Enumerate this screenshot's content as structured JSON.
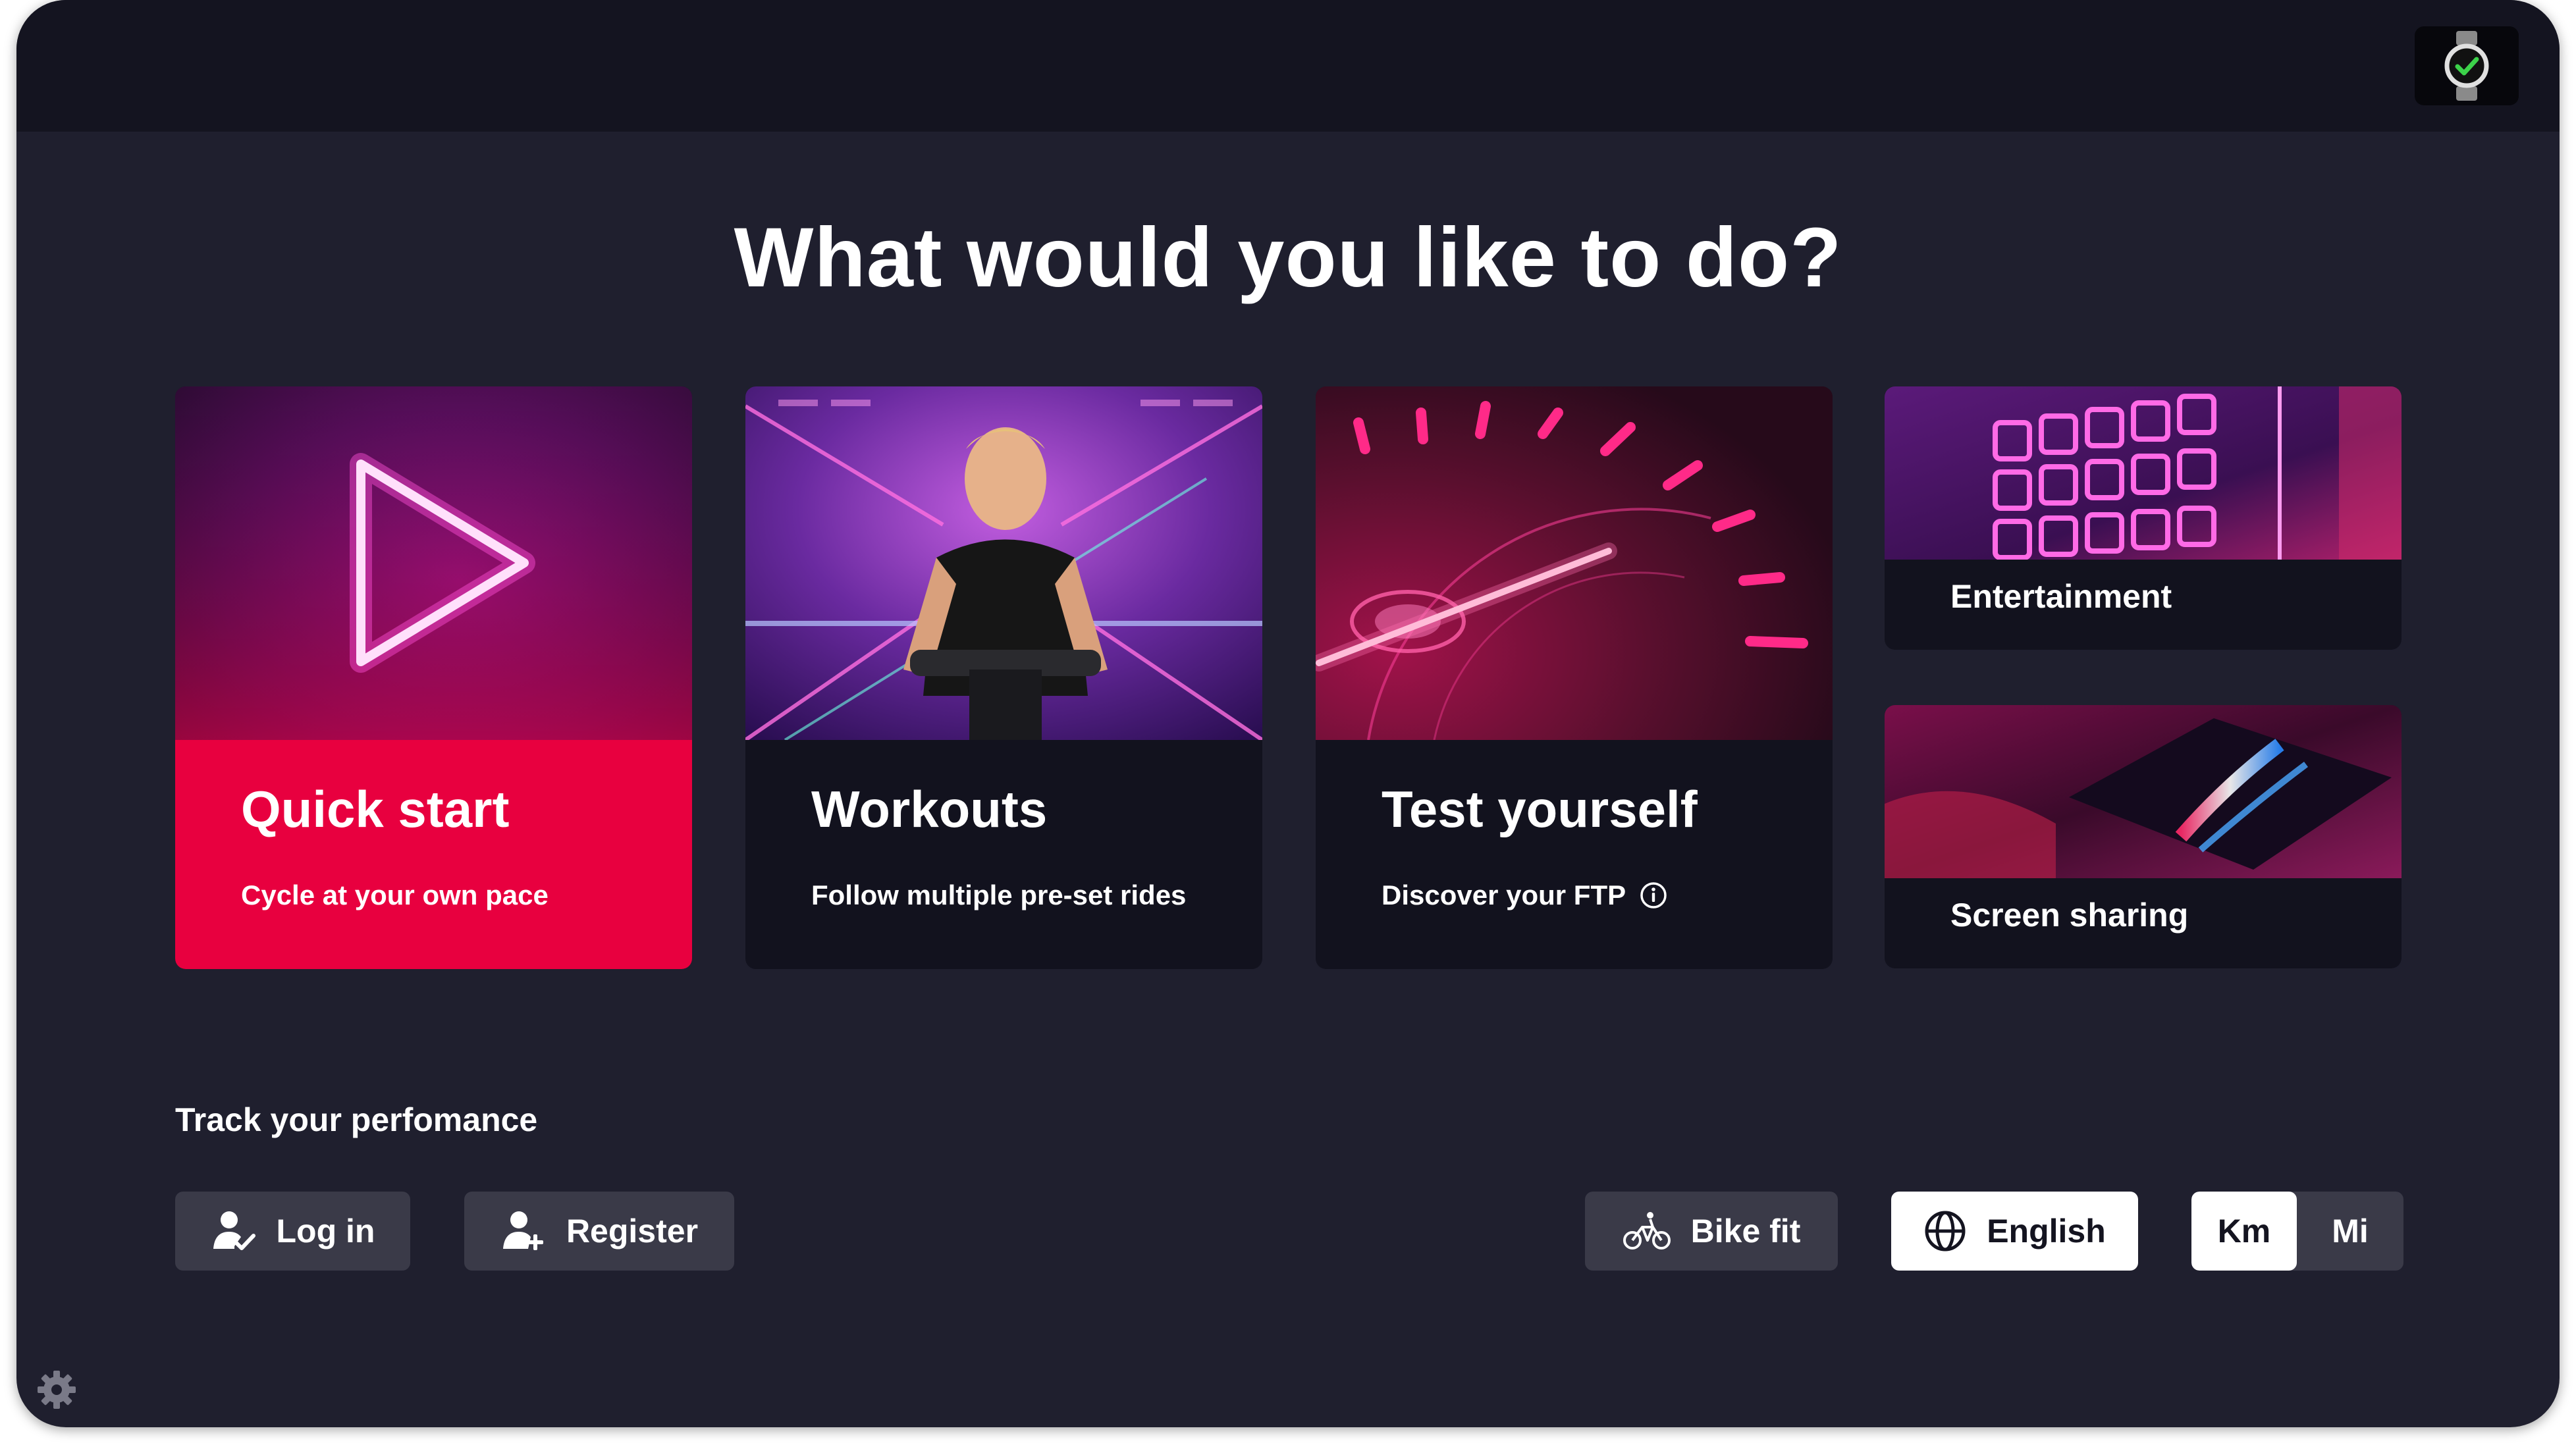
{
  "page_title": "What would you like to do?",
  "cards": {
    "quick_start": {
      "title": "Quick start",
      "subtitle": "Cycle at your own pace"
    },
    "workouts": {
      "title": "Workouts",
      "subtitle": "Follow multiple pre-set rides"
    },
    "test_yourself": {
      "title": "Test yourself",
      "subtitle": "Discover your FTP"
    },
    "entertainment": {
      "label": "Entertainment"
    },
    "screen_sharing": {
      "label": "Screen sharing"
    }
  },
  "track": {
    "label": "Track your perfomance",
    "login_label": "Log in",
    "register_label": "Register"
  },
  "bike_fit_label": "Bike fit",
  "language_label": "English",
  "units": {
    "km_label": "Km",
    "mi_label": "Mi",
    "selected": "Km"
  },
  "icons": [
    "watch-icon",
    "play-icon",
    "info-icon",
    "user-check-icon",
    "user-plus-icon",
    "bike-icon",
    "globe-icon",
    "gear-icon"
  ],
  "colors": {
    "accent": "#e8003f",
    "background": "#1f1f2e",
    "topbar": "#141420",
    "card": "#12121e",
    "button": "#3a3a48",
    "neon": "#ff1fb4"
  }
}
